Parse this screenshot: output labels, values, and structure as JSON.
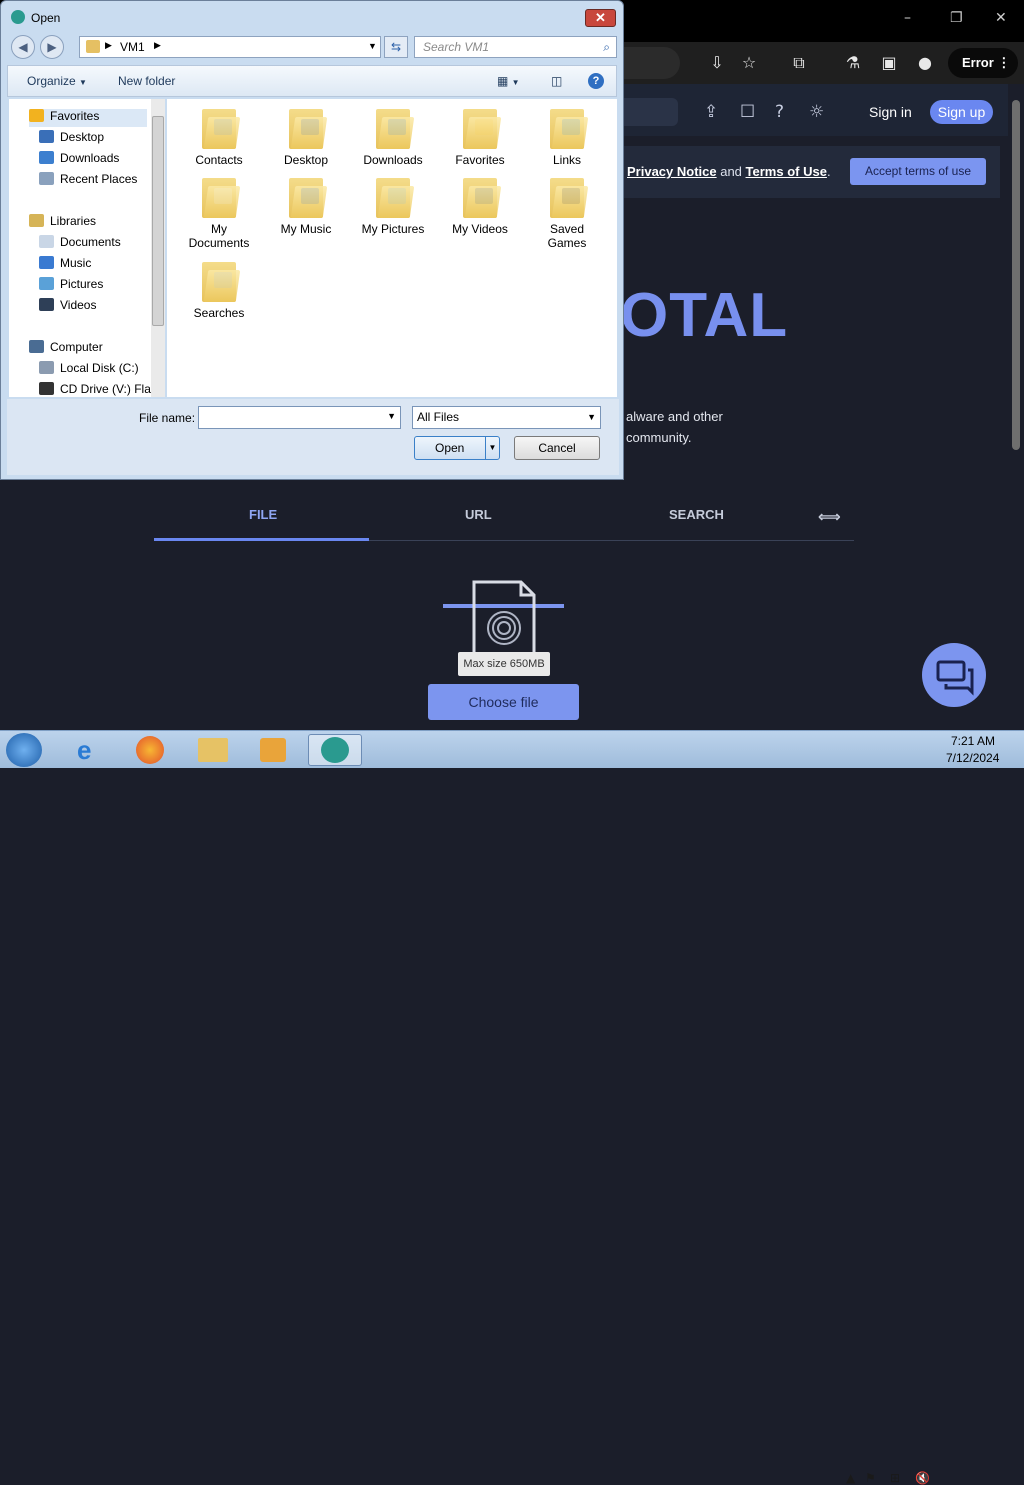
{
  "browser": {
    "window_controls": {
      "minimize": "–",
      "restore": "❐",
      "close": "✕"
    },
    "error_label": "Error",
    "header": {
      "sign_in": "Sign in",
      "sign_up": "Sign up"
    },
    "terms": {
      "privacy": "Privacy Notice",
      "and": " and ",
      "terms": "Terms of Use",
      "end": ".",
      "accept": "Accept terms of use"
    },
    "logo_fragment": "OTAL",
    "desc_line1": "alware and other",
    "desc_line2": "community.",
    "tabs": [
      {
        "label": "FILE"
      },
      {
        "label": "URL"
      },
      {
        "label": "SEARCH"
      }
    ],
    "tooltip": "Max size 650MB",
    "choose_file": "Choose file"
  },
  "dialog": {
    "title": "Open",
    "address": {
      "path": "VM1"
    },
    "search_placeholder": "Search VM1",
    "toolbar": {
      "organize": "Organize",
      "new_folder": "New folder"
    },
    "nav": [
      {
        "label": "Favorites",
        "color": "#f2b21f"
      },
      {
        "label": "Desktop",
        "color": "#3a6fb8"
      },
      {
        "label": "Downloads",
        "color": "#3c7fcf"
      },
      {
        "label": "Recent Places",
        "color": "#8aa1bd"
      },
      {
        "label": "Libraries",
        "color": "#d6b457"
      },
      {
        "label": "Documents",
        "color": "#c9d6e6"
      },
      {
        "label": "Music",
        "color": "#3a7ad1"
      },
      {
        "label": "Pictures",
        "color": "#5aa1d8"
      },
      {
        "label": "Videos",
        "color": "#2e3f57"
      },
      {
        "label": "Computer",
        "color": "#4a6c93"
      },
      {
        "label": "Local Disk (C:)",
        "color": "#8b9bb0"
      },
      {
        "label": "CD Drive (V:) Flat",
        "color": "#333333"
      }
    ],
    "folders": [
      {
        "line1": "Contacts",
        "line2": "",
        "badge": "#6f97c8"
      },
      {
        "line1": "Desktop",
        "line2": "",
        "badge": "#2f5fb0"
      },
      {
        "line1": "Downloads",
        "line2": "",
        "badge": "#2c7bd6"
      },
      {
        "line1": "Favorites",
        "line2": "",
        "badge": "#f3c43a"
      },
      {
        "line1": "Links",
        "line2": "",
        "badge": "#2a86d8"
      },
      {
        "line1": "My",
        "line2": "Documents",
        "badge": "#e9eef5"
      },
      {
        "line1": "My Music",
        "line2": "",
        "badge": "#2e69c4"
      },
      {
        "line1": "My Pictures",
        "line2": "",
        "badge": "#76b2d6"
      },
      {
        "line1": "My Videos",
        "line2": "",
        "badge": "#3e5a7c"
      },
      {
        "line1": "Saved",
        "line2": "Games",
        "badge": "#3b3b3b"
      },
      {
        "line1": "Searches",
        "line2": "",
        "badge": "#9fb7d0"
      }
    ],
    "file_name_label": "File name:",
    "file_name_value": "",
    "file_type": "All Files",
    "open": "Open",
    "cancel": "Cancel"
  },
  "taskbar": {
    "time": "7:21 AM",
    "date": "7/12/2024"
  }
}
